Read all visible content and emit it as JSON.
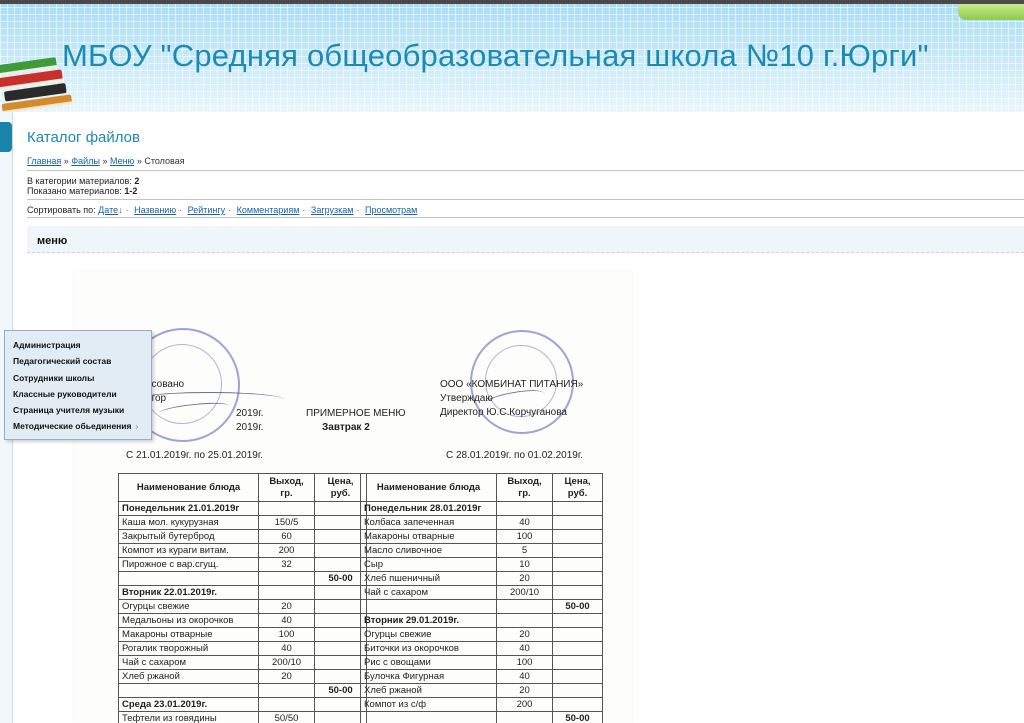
{
  "header": {
    "site_title": "МБОУ \"Средняя общеобразовательная школа №10 г.Юрги\""
  },
  "catalog": {
    "title": "Каталог файлов",
    "breadcrumbs": [
      "Главная",
      "Файлы",
      "Меню",
      "Столовая"
    ],
    "breadcrumb_sep": "»",
    "stats": {
      "in_category_label": "В категории материалов:",
      "in_category_value": "2",
      "shown_label": "Показано материалов:",
      "shown_value": "1-2"
    },
    "sort": {
      "label": "Сортировать по:",
      "options": [
        "Дате",
        "Названию",
        "Рейтингу",
        "Комментариям",
        "Загрузкам",
        "Просмотрам"
      ],
      "active_indicator": "↓"
    },
    "entry_title": "меню"
  },
  "dropdown": {
    "items": [
      {
        "label": "Администрация",
        "has_submenu": false
      },
      {
        "label": "Педагогический состав",
        "has_submenu": false
      },
      {
        "label": "Сотрудники школы",
        "has_submenu": false
      },
      {
        "label": "Классные руководители",
        "has_submenu": false
      },
      {
        "label": "Страница учителя музыки",
        "has_submenu": false
      },
      {
        "label": "Методические обьединения",
        "has_submenu": true
      }
    ],
    "submenu_arrow": "›"
  },
  "document": {
    "left_head": [
      "асовано",
      "ктор"
    ],
    "left_date1": "2019г.",
    "left_date2": "2019г.",
    "center_title": "ПРИМЕРНОЕ МЕНЮ",
    "center_subtitle": "Завтрак 2",
    "right_head": [
      "ООО «КОМБИНАТ ПИТАНИЯ»",
      "Утверждаю",
      "Директор Ю.С.Корчуганова"
    ],
    "left_period": "С 21.01.2019г. по 25.01.2019г.",
    "right_period": "С 28.01.2019г. по 01.02.2019г.",
    "columns": [
      "Наименование блюда",
      "Выход, гр.",
      "Цена, руб."
    ],
    "left_table": [
      {
        "kind": "day",
        "name": "Понедельник 21.01.2019г"
      },
      {
        "kind": "item",
        "name": "Каша мол. кукурузная",
        "out": "150/5"
      },
      {
        "kind": "item",
        "name": "Закрытый бутерброд",
        "out": "60"
      },
      {
        "kind": "item",
        "name": "Компот из кураги витам.",
        "out": "200"
      },
      {
        "kind": "item",
        "name": "Пирожное с вар.сгущ.",
        "out": "32"
      },
      {
        "kind": "price",
        "price": "50-00"
      },
      {
        "kind": "day",
        "name": "Вторник 22.01.2019г."
      },
      {
        "kind": "item",
        "name": "Огурцы свежие",
        "out": "20"
      },
      {
        "kind": "item",
        "name": "Медальоны из окорочков",
        "out": "40"
      },
      {
        "kind": "item",
        "name": "Макароны отварные",
        "out": "100"
      },
      {
        "kind": "item",
        "name": "Рогалик творожный",
        "out": "40"
      },
      {
        "kind": "item",
        "name": "Чай с сахаром",
        "out": "200/10"
      },
      {
        "kind": "item",
        "name": "Хлеб ржаной",
        "out": "20"
      },
      {
        "kind": "price",
        "price": "50-00"
      },
      {
        "kind": "day",
        "name": "Среда 23.01.2019г."
      },
      {
        "kind": "item",
        "name": "Тефтели из говядины",
        "out": "50/50"
      }
    ],
    "right_table": [
      {
        "kind": "day",
        "name": "Понедельник 28.01.2019г"
      },
      {
        "kind": "item",
        "name": "Колбаса запеченная",
        "out": "40"
      },
      {
        "kind": "item",
        "name": "Макароны отварные",
        "out": "100"
      },
      {
        "kind": "item",
        "name": "Масло сливочное",
        "out": "5"
      },
      {
        "kind": "item",
        "name": "Сыр",
        "out": "10"
      },
      {
        "kind": "item",
        "name": "Хлеб пшеничный",
        "out": "20"
      },
      {
        "kind": "item",
        "name": "Чай с сахаром",
        "out": "200/10"
      },
      {
        "kind": "price",
        "price": "50-00"
      },
      {
        "kind": "day",
        "name": "Вторник 29.01.2019г."
      },
      {
        "kind": "item",
        "name": "Огурцы свежие",
        "out": "20"
      },
      {
        "kind": "item",
        "name": "Биточки из окорочков",
        "out": "40"
      },
      {
        "kind": "item",
        "name": "Рис с овощами",
        "out": "100"
      },
      {
        "kind": "item",
        "name": "Булочка Фигурная",
        "out": "40"
      },
      {
        "kind": "item",
        "name": "Хлеб ржаной",
        "out": "20"
      },
      {
        "kind": "item",
        "name": "Компот из с/ф",
        "out": "200"
      },
      {
        "kind": "price",
        "price": "50-00"
      }
    ]
  }
}
